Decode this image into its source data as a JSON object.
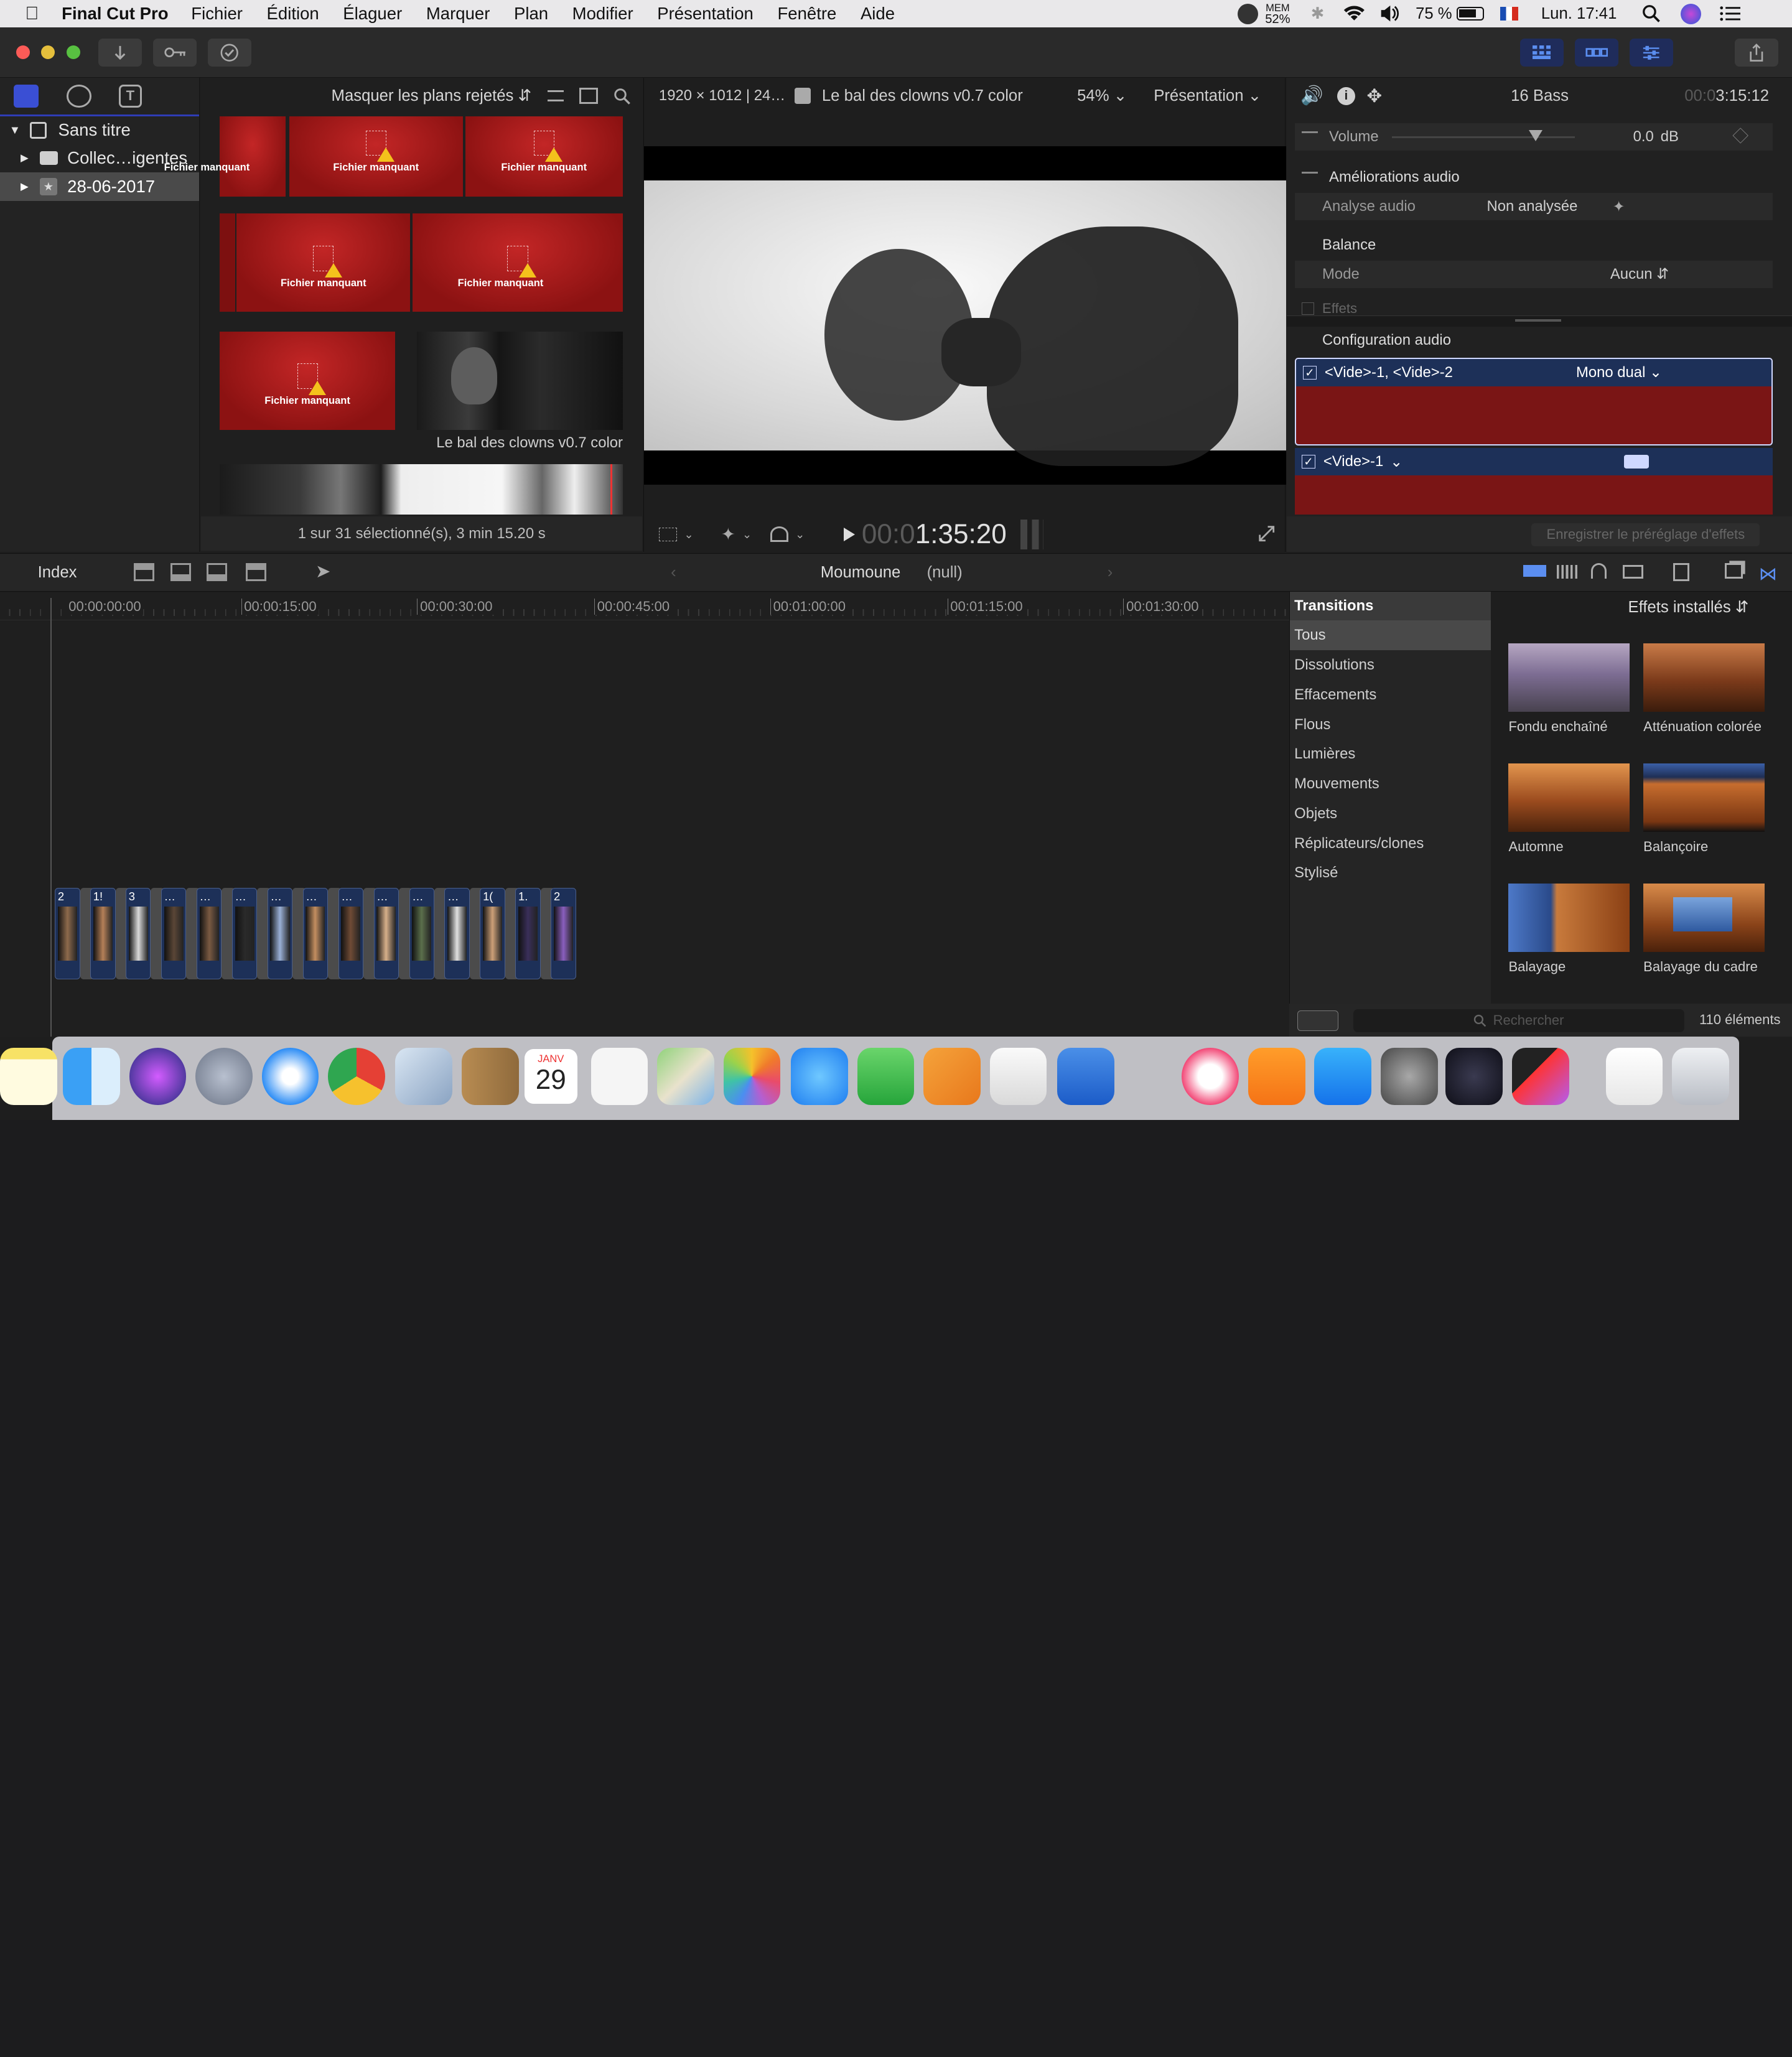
{
  "menubar": {
    "app": "Final Cut Pro",
    "items": [
      "Fichier",
      "Édition",
      "Élaguer",
      "Marquer",
      "Plan",
      "Modifier",
      "Présentation",
      "Fenêtre",
      "Aide"
    ],
    "mem_label": "MEM",
    "mem_value": "52%",
    "battery": "75 %",
    "clock": "Lun. 17:41"
  },
  "browser": {
    "filter": "Masquer les plans rejetés",
    "library": "Sans titre",
    "items": [
      "Collec…igentes",
      "28-06-2017"
    ],
    "missing_label": "Fichier manquant",
    "clip_caption": "Le bal des clowns v0.7 color",
    "status": "1 sur 31 sélectionné(s), 3 min 15.20 s"
  },
  "viewer": {
    "format": "1920 × 1012 | 24…",
    "project": "Le bal des clowns v0.7 color",
    "zoom": "54%",
    "view": "Présentation",
    "timecode_dim": "00:0",
    "timecode": "1:35:20"
  },
  "inspector": {
    "clip_name": "16 Bass",
    "timecode_dim": "00:0",
    "timecode": "3:15:12",
    "volume_label": "Volume",
    "volume_value": "0.0",
    "volume_unit": "dB",
    "enhance_label": "Améliorations audio",
    "analysis_label": "Analyse audio",
    "analysis_value": "Non analysée",
    "balance_label": "Balance",
    "mode_label": "Mode",
    "mode_value": "Aucun",
    "effects_label": "Effets",
    "config_label": "Configuration audio",
    "ch1": "<Vide>-1, <Vide>-2",
    "ch1_mode": "Mono dual",
    "ch2": "<Vide>-1",
    "save_preset": "Enregistrer le préréglage d'effets"
  },
  "timeline": {
    "index": "Index",
    "project": "Moumoune",
    "project_sub": "(null)",
    "ruler": [
      "00:00:00:00",
      "00:00:15:00",
      "00:00:30:00",
      "00:00:45:00",
      "00:01:00:00",
      "00:01:15:00",
      "00:01:30:00"
    ],
    "clip_labels": [
      "2",
      "1!",
      "3",
      "…",
      "…",
      "…",
      "…",
      "…",
      "…",
      "…",
      "…",
      "…",
      "1(",
      "1.",
      "2"
    ]
  },
  "effects": {
    "header": "Transitions",
    "installed": "Effets installés",
    "categories": [
      "Tous",
      "Dissolutions",
      "Effacements",
      "Flous",
      "Lumières",
      "Mouvements",
      "Objets",
      "Réplicateurs/clones",
      "Stylisé"
    ],
    "tiles": [
      "Fondu enchaîné",
      "Atténuation colorée",
      "Automne",
      "Balançoire",
      "Balayage",
      "Balayage du cadre"
    ],
    "search_placeholder": "Rechercher",
    "count": "110 éléments"
  },
  "dock": {
    "calendar_month": "JANV",
    "calendar_day": "29"
  }
}
